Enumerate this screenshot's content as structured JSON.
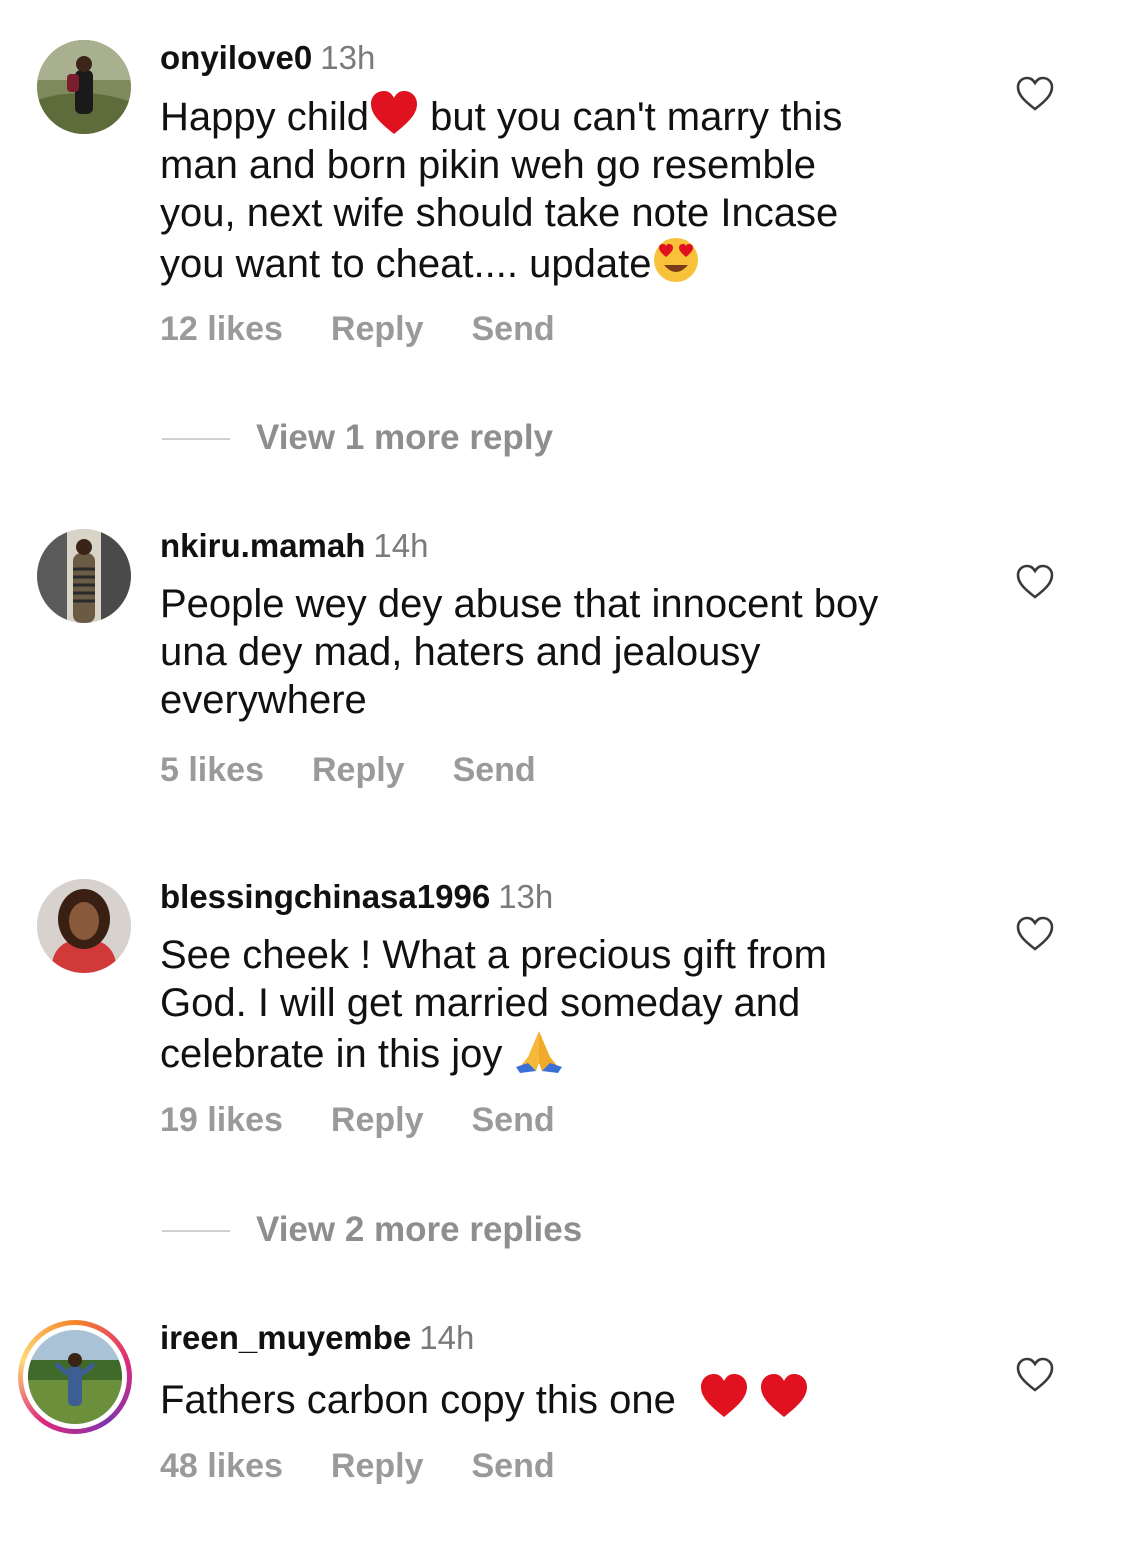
{
  "comments": [
    {
      "username": "onyilove0",
      "time": "13h",
      "lines": [
        "Happy child",
        " but you can't marry this",
        "man and born pikin weh go resemble",
        "you, next wife should take note Incase",
        "you want to cheat.... update"
      ],
      "likes": "12 likes",
      "reply": "Reply",
      "send": "Send",
      "view_more": "View 1 more reply"
    },
    {
      "username": "nkiru.mamah",
      "time": "14h",
      "lines": [
        "People wey dey abuse that innocent boy",
        "una dey mad, haters and jealousy",
        "everywhere"
      ],
      "likes": "5 likes",
      "reply": "Reply",
      "send": "Send"
    },
    {
      "username": "blessingchinasa1996",
      "time": "13h",
      "lines": [
        "See cheek ! What a precious gift from",
        "God. I will get married someday and",
        "celebrate in this joy "
      ],
      "likes": "19 likes",
      "reply": "Reply",
      "send": "Send",
      "view_more": "View 2 more replies"
    },
    {
      "username": "ireen_muyembe",
      "time": "14h",
      "lines": [
        "Fathers carbon copy this one "
      ],
      "likes": "48 likes",
      "reply": "Reply",
      "send": "Send"
    }
  ],
  "icons": {
    "like": "heart-outline-icon",
    "emoji_heart": "red-heart-emoji",
    "emoji_heart_eyes": "heart-eyes-emoji",
    "emoji_pray": "folded-hands-emoji"
  },
  "colors": {
    "text": "#111111",
    "secondary": "#8e8e8e",
    "heart": "#e0121f",
    "story_ring": "#dd2a7b"
  }
}
